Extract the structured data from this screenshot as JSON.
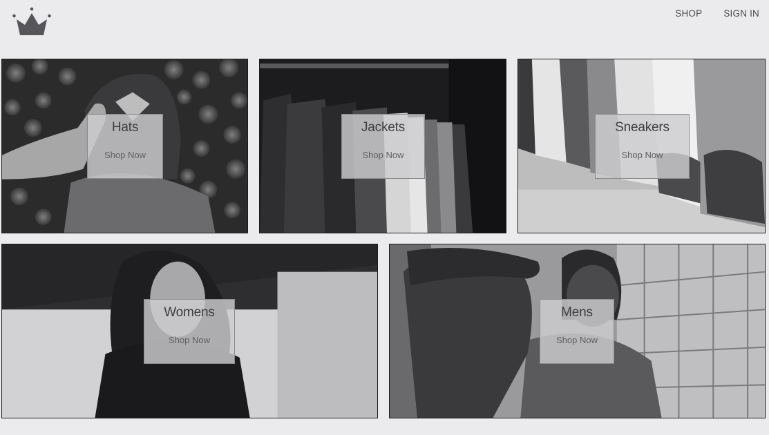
{
  "header": {
    "logo_icon": "crown-icon",
    "nav": {
      "shop": "SHOP",
      "sign_in": "SIGN IN"
    }
  },
  "categories": [
    {
      "title": "Hats",
      "cta": "Shop Now"
    },
    {
      "title": "Jackets",
      "cta": "Shop Now"
    },
    {
      "title": "Sneakers",
      "cta": "Shop Now"
    },
    {
      "title": "Womens",
      "cta": "Shop Now"
    },
    {
      "title": "Mens",
      "cta": "Shop Now"
    }
  ],
  "colors": {
    "background": "#ebebed",
    "card": "#cdcdcf",
    "text": "#3d3d3f"
  }
}
